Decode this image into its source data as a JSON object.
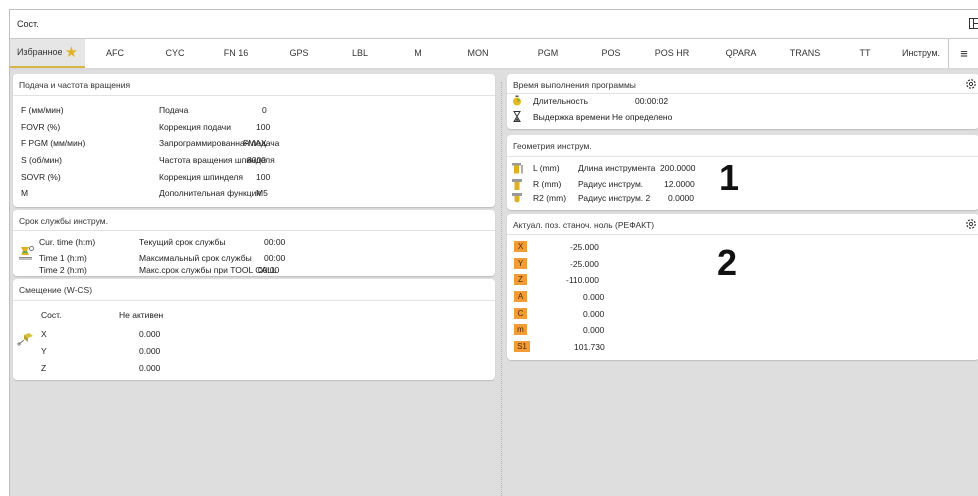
{
  "titlebar": {
    "title": "Сост."
  },
  "tabs": [
    "Избранное",
    "AFC",
    "CYC",
    "FN 16",
    "GPS",
    "LBL",
    "M",
    "MON",
    "PGM",
    "POS",
    "POS HR",
    "QPARA",
    "TRANS",
    "TT",
    "Инструм."
  ],
  "colors": {
    "accent": "#d7b64a",
    "badge": "#f39c35",
    "star": "#e3b22a"
  },
  "feed": {
    "title": "Подача и частота вращения",
    "rows": [
      {
        "label": "F (мм/мин)",
        "desc": "Подача",
        "value": "0"
      },
      {
        "label": "FOVR (%)",
        "desc": "Коррекция подачи",
        "value": "100"
      },
      {
        "label": "F PGM (мм/мин)",
        "desc": "Запрограммированная подача",
        "value": "FMAX"
      },
      {
        "label": "S (об/мин)",
        "desc": "Частота вращения шпинделя",
        "value": "8000"
      },
      {
        "label": "SOVR (%)",
        "desc": "Коррекция шпинделя",
        "value": "100"
      },
      {
        "label": "M",
        "desc": "Дополнительная функция",
        "value": "M5"
      }
    ]
  },
  "life": {
    "title": "Срок службы инструм.",
    "rows": [
      {
        "label": "Cur. time (h:m)",
        "desc": "Текущий срок службы",
        "value": "00:00"
      },
      {
        "label": "Time 1 (h:m)",
        "desc": "Максимальный срок службы",
        "value": "00:00"
      },
      {
        "label": "Time 2 (h:m)",
        "desc": "Макс.срок службы при TOOL CALL",
        "value": "00:00"
      }
    ]
  },
  "offset": {
    "title": "Смещение (W-CS)",
    "rows": [
      {
        "label": "Сост.",
        "value": "Не активен"
      },
      {
        "label": "X",
        "value": "0.000"
      },
      {
        "label": "Y",
        "value": "0.000"
      },
      {
        "label": "Z",
        "value": "0.000"
      }
    ]
  },
  "runtime": {
    "title": "Время выполнения программы",
    "rows": [
      {
        "label": "Длительность",
        "value": "00:00:02"
      },
      {
        "label": "Выдержка времени",
        "value": "Не определено"
      }
    ]
  },
  "geometry": {
    "title": "Геометрия инструм.",
    "rows": [
      {
        "label": "L (mm)",
        "desc": "Длина инструмента",
        "value": "200.0000"
      },
      {
        "label": "R (mm)",
        "desc": "Радиус инструм.",
        "value": "12.0000"
      },
      {
        "label": "R2 (mm)",
        "desc": "Радиус инструм. 2",
        "value": "0.0000"
      }
    ]
  },
  "position": {
    "title": "Актуал. поз. станоч. ноль (РЕФАКТ)",
    "rows": [
      {
        "axis": "X",
        "value": "-25.000"
      },
      {
        "axis": "Y",
        "value": "-25.000"
      },
      {
        "axis": "Z",
        "value": "-110.000"
      },
      {
        "axis": "A",
        "value": "0.000"
      },
      {
        "axis": "C",
        "value": "0.000"
      },
      {
        "axis": "m",
        "value": "0.000"
      },
      {
        "axis": "S1",
        "value": "101.730"
      }
    ]
  },
  "callouts": [
    "1",
    "2"
  ]
}
